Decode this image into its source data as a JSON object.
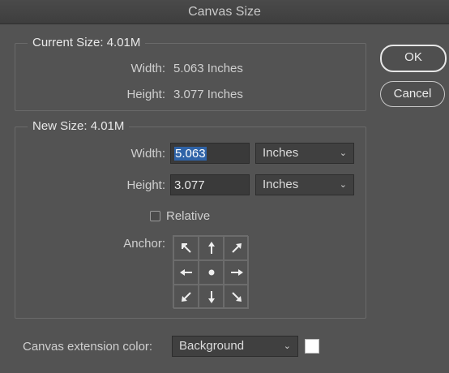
{
  "dialog": {
    "title": "Canvas Size"
  },
  "current_size": {
    "legend": "Current Size: 4.01M",
    "width_label": "Width:",
    "width_value": "5.063 Inches",
    "height_label": "Height:",
    "height_value": "3.077 Inches"
  },
  "buttons": {
    "ok": "OK",
    "cancel": "Cancel"
  },
  "new_size": {
    "legend": "New Size: 4.01M",
    "width_label": "Width:",
    "width_value": "5.063",
    "width_unit": "Inches",
    "height_label": "Height:",
    "height_value": "3.077",
    "height_unit": "Inches",
    "relative_label": "Relative",
    "relative_checked": false,
    "anchor_label": "Anchor:",
    "anchor_selected": "center"
  },
  "extension": {
    "label": "Canvas extension color:",
    "value": "Background",
    "swatch_color": "#ffffff"
  },
  "icons": {
    "select_chevron": "chevron-down-icon",
    "anchor": [
      "arrow-up-left-icon",
      "arrow-up-icon",
      "arrow-up-right-icon",
      "arrow-left-icon",
      "anchor-dot-icon",
      "arrow-right-icon",
      "arrow-down-left-icon",
      "arrow-down-icon",
      "arrow-down-right-icon"
    ]
  }
}
